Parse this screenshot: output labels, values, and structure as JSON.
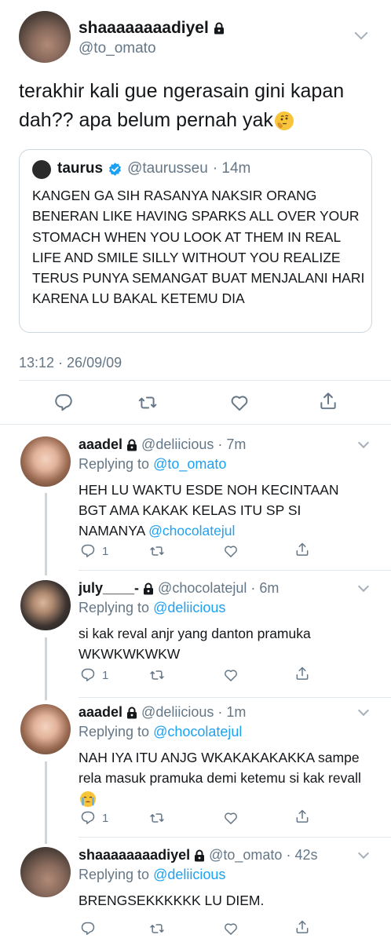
{
  "main_tweet": {
    "author_name": "shaaaaaaaadiyel",
    "author_handle": "@to_omato",
    "text": "terakhir kali gue ngerasain gini kapan dah?? apa belum pernah yak",
    "timestamp": "13:12 · 26/09/09",
    "quoted": {
      "name": "taurus",
      "handle": "@taurusseu",
      "time": "· 14m",
      "text": "KANGEN GA SIH RASANYA NAKSIR ORANG BENERAN LIKE HAVING SPARKS ALL OVER YOUR STOMACH WHEN YOU LOOK AT THEM IN REAL LIFE AND SMILE SILLY WITHOUT YOU REALIZE TERUS PUNYA SEMANGAT BUAT MENJALANI HARI KARENA LU BAKAL KETEMU DIA"
    }
  },
  "replies": [
    {
      "name": "aaadel",
      "handle": "@deliicious",
      "time": "· 7m",
      "replying_label": "Replying to",
      "replying_to": "@to_omato",
      "text_before": "HEH LU WAKTU ESDE NOH KECINTAAN BGT AMA KAKAK KELAS ITU SP SI NAMANYA ",
      "mention": "@chocolatejul",
      "reply_count": "1"
    },
    {
      "name": "july____-",
      "handle": "@chocolatejul",
      "time": "· 6m",
      "replying_label": "Replying to",
      "replying_to": "@deliicious",
      "text_before": "si kak reval anjr yang danton pramuka WKWKWKWKW",
      "reply_count": "1"
    },
    {
      "name": "aaadel",
      "handle": "@deliicious",
      "time": "· 1m",
      "replying_label": "Replying to",
      "replying_to": "@chocolatejul",
      "text_before": "NAH IYA ITU ANJG WKAKAKAKAKKA sampe rela masuk pramuka demi ketemu si kak revall",
      "reply_count": "1"
    },
    {
      "name": "shaaaaaaaadiyel",
      "handle": "@to_omato",
      "time": "· 42s",
      "replying_label": "Replying to",
      "replying_to": "@deliicious",
      "text_before": "BRENGSEKKKKKK LU DIEM."
    }
  ],
  "icons": {
    "reply": "speech-bubble-icon",
    "retweet": "retweet-arrows-icon",
    "like": "heart-icon",
    "share": "share-upload-icon",
    "protected": "lock-icon",
    "verified": "verified-badge-icon",
    "more": "chevron-down-icon"
  },
  "colors": {
    "accent": "#1da1f2",
    "secondary_text": "#657786",
    "text": "#14171a",
    "divider": "#e1e8ed"
  }
}
